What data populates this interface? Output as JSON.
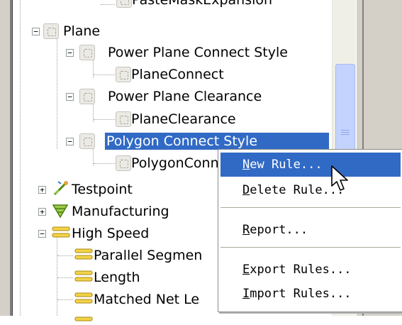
{
  "tree": {
    "items": [
      {
        "label": "PasteMaskExpansion"
      },
      {
        "label": "Plane"
      },
      {
        "label": "Power Plane Connect Style"
      },
      {
        "label": "PlaneConnect"
      },
      {
        "label": "Power Plane Clearance"
      },
      {
        "label": "PlaneClearance"
      },
      {
        "label": "Polygon Connect Style"
      },
      {
        "label": "PolygonConn"
      },
      {
        "label": "Testpoint"
      },
      {
        "label": "Manufacturing"
      },
      {
        "label": "High Speed"
      },
      {
        "label": "Parallel Segmen"
      },
      {
        "label": "Length"
      },
      {
        "label": "Matched Net Le"
      }
    ],
    "expand_open": "−",
    "expand_closed": "+"
  },
  "context_menu": {
    "items": [
      {
        "accel": "N",
        "rest": "ew Rule..."
      },
      {
        "accel": "D",
        "rest": "elete Rule..."
      },
      {
        "accel": "R",
        "rest": "eport..."
      },
      {
        "accel": "E",
        "rest": "xport Rules..."
      },
      {
        "accel": "I",
        "rest": "mport Rules..."
      }
    ]
  },
  "colors": {
    "selection": "#316ac5",
    "scroll_thumb": "#c3d3fd"
  }
}
